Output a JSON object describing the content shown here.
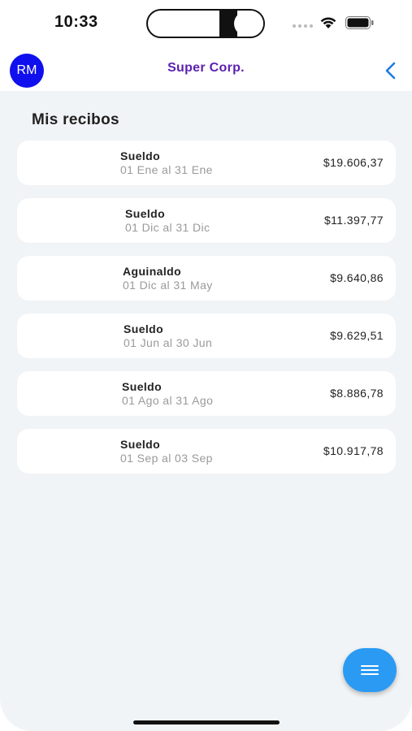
{
  "status_bar": {
    "time": "10:33",
    "icons": [
      "cellular-icon",
      "wifi-icon",
      "battery-icon"
    ]
  },
  "header": {
    "avatar_initials": "RM",
    "title": "Super Corp.",
    "back_icon": "chevron-left-icon"
  },
  "section": {
    "title": "Mis recibos"
  },
  "receipts": [
    {
      "type": "Sueldo",
      "period": "01 Ene al 31 Ene",
      "amount": "$19.606,37"
    },
    {
      "type": "Sueldo",
      "period": "01 Dic al 31 Dic",
      "amount": "$11.397,77"
    },
    {
      "type": "Aguinaldo",
      "period": "01 Dic al 31 May",
      "amount": "$9.640,86"
    },
    {
      "type": "Sueldo",
      "period": "01 Jun al 30 Jun",
      "amount": "$9.629,51"
    },
    {
      "type": "Sueldo",
      "period": "01 Ago al 31 Ago",
      "amount": "$8.886,78"
    },
    {
      "type": "Sueldo",
      "period": "01 Sep al 03 Sep",
      "amount": "$10.917,78"
    }
  ],
  "fab": {
    "icon": "menu-icon"
  },
  "colors": {
    "avatar_bg": "#1010ee",
    "title": "#5b1fb0",
    "accent": "#2b9af3",
    "back_chevron": "#1e7be0",
    "content_bg": "#f1f4f6"
  }
}
